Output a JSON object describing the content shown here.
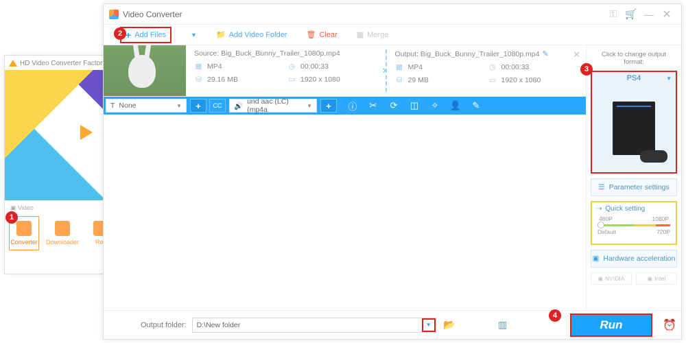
{
  "bgwin": {
    "title": "HD Video Converter Factory Pro",
    "section": "Video",
    "tiles": [
      {
        "label": "Converter"
      },
      {
        "label": "Downloader"
      },
      {
        "label": "Rec"
      }
    ]
  },
  "header": {
    "title": "Video Converter"
  },
  "toolbar": {
    "add_files": "Add Files",
    "add_folder": "Add Video Folder",
    "clear": "Clear",
    "merge": "Merge"
  },
  "file": {
    "source_label": "Source:",
    "source_name": "Big_Buck_Bunny_Trailer_1080p.mp4",
    "output_label": "Output:",
    "output_name": "Big_Buck_Bunny_Trailer_1080p.mp4",
    "src": {
      "format": "MP4",
      "duration": "00:00:33",
      "size": "29.16 MB",
      "res": "1920 x 1080"
    },
    "out": {
      "format": "MP4",
      "duration": "00:00:33",
      "size": "29 MB",
      "res": "1920 x 1080"
    }
  },
  "bluebar": {
    "subtitle": "None",
    "audio": "und aac (LC) (mp4a"
  },
  "sidebar": {
    "hint": "Click to change output format:",
    "format": "PS4",
    "param": "Parameter settings",
    "quick": "Quick setting",
    "ticks_top": {
      "a": "480P",
      "b": "1080P"
    },
    "ticks_bot": {
      "a": "Default",
      "b": "720P"
    },
    "hw": "Hardware acceleration",
    "vendors": {
      "a": "NVIDIA",
      "b": "Intel"
    }
  },
  "footer": {
    "label": "Output folder:",
    "path": "D:\\New folder",
    "run": "Run"
  },
  "badges": {
    "b1": "1",
    "b2": "2",
    "b3": "3",
    "b4": "4"
  }
}
